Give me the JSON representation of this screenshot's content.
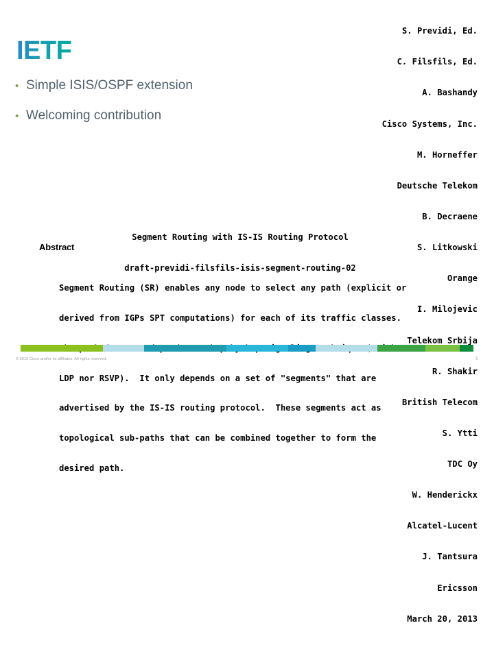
{
  "slide": {
    "logo_text": "IETF",
    "bullets": [
      {
        "marker": "•",
        "label": "Simple ISIS/OSPF extension"
      },
      {
        "marker": "•",
        "label": "Welcoming contribution"
      }
    ]
  },
  "document": {
    "authors": [
      "S. Previdi, Ed.",
      "C. Filsfils, Ed.",
      "A. Bashandy",
      "Cisco Systems, Inc.",
      "M. Horneffer",
      "Deutsche Telekom",
      "B. Decraene",
      "S. Litkowski",
      "Orange",
      "I. Milojevic",
      "Telekom Srbija",
      "R. Shakir",
      "British Telecom",
      "S. Ytti",
      "TDC Oy",
      "W. Henderickx",
      "Alcatel-Lucent",
      "J. Tantsura",
      "Ericsson",
      "March 20, 2013"
    ],
    "title_lines": [
      "Segment Routing with IS-IS Routing Protocol",
      "draft-previdi-filsfils-isis-segment-routing-02"
    ],
    "abstract_heading": "Abstract",
    "abstract_lines": [
      "Segment Routing (SR) enables any node to select any path (explicit or",
      "derived from IGPs SPT computations) for each of its traffic classes.",
      "The path does not depend on a hop-by-hop signaling technique (neither",
      "LDP nor RSVP).  It only depends on a set of \"segments\" that are",
      "advertised by the IS-IS routing protocol.  These segments act as",
      "topological sub-paths that can be combined together to form the",
      "desired path."
    ]
  },
  "footer": {
    "copyright": "© 2010 Cisco and/or its affiliates. All rights reserved.",
    "page_number": "8",
    "bar_segments": [
      {
        "color": "#8cc01f",
        "width": 18.2
      },
      {
        "color": "#b3dde8",
        "width": 9.1
      },
      {
        "color": "#1f9bb0",
        "width": 18.2
      },
      {
        "color": "#29b6d8",
        "width": 13.6
      },
      {
        "color": "#1a9cc4",
        "width": 6.1
      },
      {
        "color": "#b3dde8",
        "width": 13.6
      },
      {
        "color": "#3ba345",
        "width": 10.6
      },
      {
        "color": "#7cc043",
        "width": 7.6
      },
      {
        "color": "#0e8c3a",
        "width": 3.0
      }
    ],
    "bar_gradient_start": "#0e8c3a",
    "bar_gradient_mid": "#3cc1cf",
    "bar_gradient_end": "#8cb817",
    "accent_teal": "#00a99d",
    "accent_blue": "#2e86c9"
  }
}
